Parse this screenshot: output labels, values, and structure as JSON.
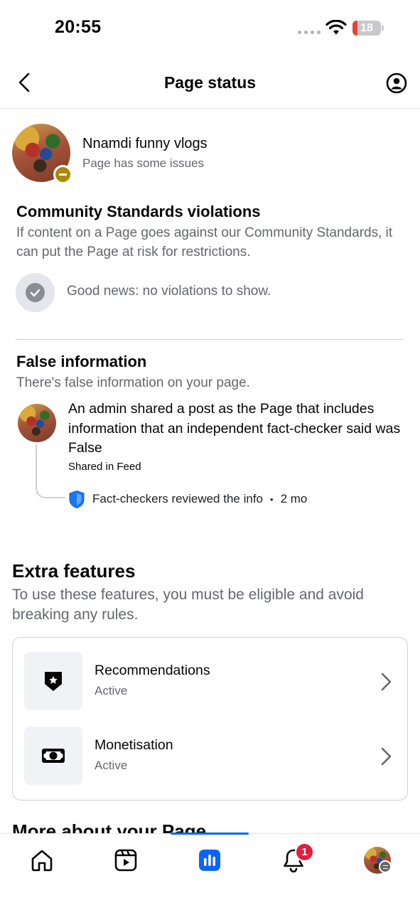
{
  "status_bar": {
    "time": "20:55",
    "battery_level": "18",
    "battery_fraction": 0.18
  },
  "header": {
    "title": "Page status"
  },
  "page": {
    "name": "Nnamdi funny vlogs",
    "status": "Page has some issues"
  },
  "community": {
    "title": "Community Standards violations",
    "description": "If content on a Page goes against our Community Standards, it can put the Page at risk for restrictions.",
    "good_news": "Good news: no violations to show."
  },
  "false_info": {
    "title": "False information",
    "description": "There's false information on your page.",
    "item_text": "An admin shared a post as the Page that includes information that an independent fact-checker said was False",
    "shared_in": "Shared in Feed",
    "review_text": "Fact-checkers reviewed the info",
    "review_separator": "•",
    "review_time": "2 mo"
  },
  "extra": {
    "title": "Extra features",
    "description": "To use these features, you must be eligible and avoid breaking any rules.",
    "features": [
      {
        "label": "Recommendations",
        "status": "Active",
        "icon": "badge-star-icon"
      },
      {
        "label": "Monetisation",
        "status": "Active",
        "icon": "money-icon"
      }
    ]
  },
  "more": {
    "title": "More about your Page"
  },
  "tabbar": {
    "tabs": [
      {
        "name": "home",
        "icon": "home-icon"
      },
      {
        "name": "reels",
        "icon": "video-icon"
      },
      {
        "name": "insights",
        "icon": "insights-icon",
        "active": true
      },
      {
        "name": "notifications",
        "icon": "bell-icon"
      },
      {
        "name": "profile",
        "icon": "avatar"
      }
    ],
    "notification_count": "1"
  },
  "colors": {
    "accent": "#0866ff",
    "badge": "#e41e3f",
    "warning": "#a88a00",
    "secondary_text": "#65676b"
  }
}
